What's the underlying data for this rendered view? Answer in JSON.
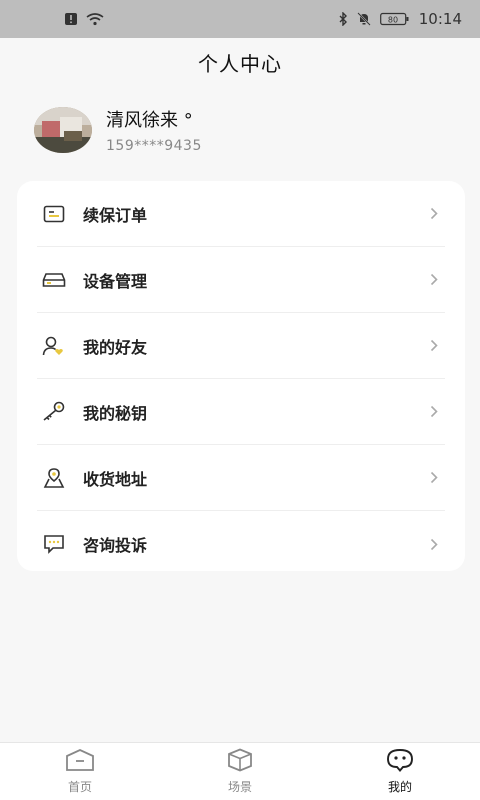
{
  "status_bar": {
    "time": "10:14",
    "battery": "80"
  },
  "header": {
    "title": "个人中心"
  },
  "profile": {
    "username": "清风徐来 °",
    "phone": "159****9435"
  },
  "menu": {
    "items": [
      {
        "label": "续保订单",
        "icon": "order-icon"
      },
      {
        "label": "设备管理",
        "icon": "device-icon"
      },
      {
        "label": "我的好友",
        "icon": "friend-icon"
      },
      {
        "label": "我的秘钥",
        "icon": "key-icon"
      },
      {
        "label": "收货地址",
        "icon": "address-icon"
      },
      {
        "label": "咨询投诉",
        "icon": "message-icon"
      }
    ]
  },
  "tabs": [
    {
      "label": "首页",
      "icon": "home-icon",
      "active": false
    },
    {
      "label": "场景",
      "icon": "box-icon",
      "active": false
    },
    {
      "label": "我的",
      "icon": "mine-icon",
      "active": true
    }
  ],
  "colors": {
    "accent": "#e8c840",
    "background": "#f7f7f7",
    "status_bar": "#bdbdbd"
  }
}
